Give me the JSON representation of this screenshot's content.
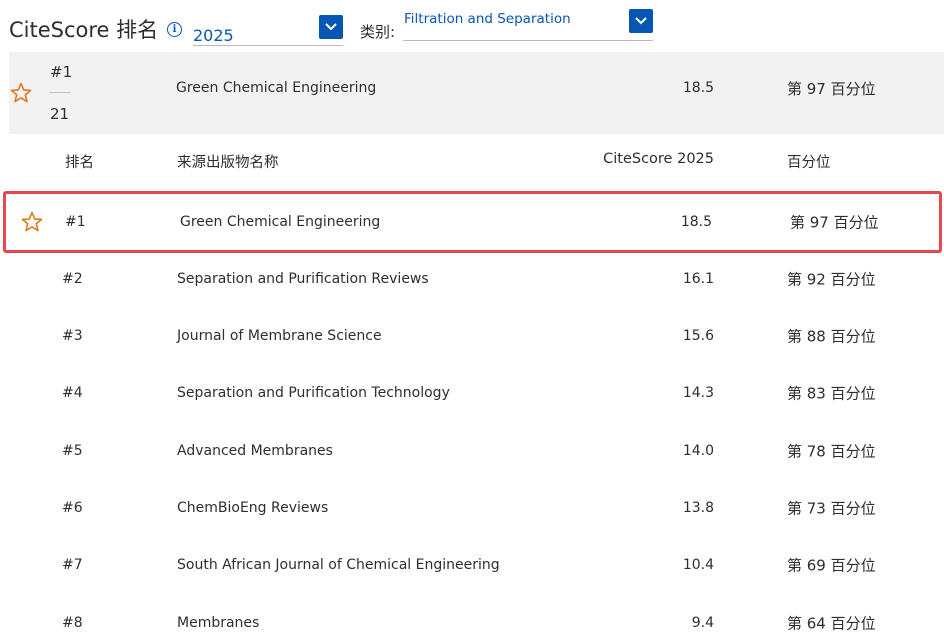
{
  "header": {
    "title": "CiteScore 排名",
    "year": "2025",
    "category_label": "类别:",
    "category": "Filtration and Separation"
  },
  "summary": {
    "rank": "#1",
    "total": "21",
    "name": "Green Chemical Engineering",
    "score": "18.5",
    "percentile": "第 97 百分位"
  },
  "columns": {
    "rank": "排名",
    "name": "来源出版物名称",
    "score": "CiteScore 2025",
    "percentile": "百分位"
  },
  "rows": [
    {
      "rank": "#1",
      "name": "Green Chemical Engineering",
      "score": "18.5",
      "percentile": "第 97 百分位"
    },
    {
      "rank": "#2",
      "name": "Separation and Purification Reviews",
      "score": "16.1",
      "percentile": "第 92 百分位"
    },
    {
      "rank": "#3",
      "name": "Journal of Membrane Science",
      "score": "15.6",
      "percentile": "第 88 百分位"
    },
    {
      "rank": "#4",
      "name": "Separation and Purification Technology",
      "score": "14.3",
      "percentile": "第 83 百分位"
    },
    {
      "rank": "#5",
      "name": "Advanced Membranes",
      "score": "14.0",
      "percentile": "第 78 百分位"
    },
    {
      "rank": "#6",
      "name": "ChemBioEng Reviews",
      "score": "13.8",
      "percentile": "第 73 百分位"
    },
    {
      "rank": "#7",
      "name": "South African Journal of Chemical Engineering",
      "score": "10.4",
      "percentile": "第 69 百分位"
    },
    {
      "rank": "#8",
      "name": "Membranes",
      "score": "9.4",
      "percentile": "第 64 百分位"
    }
  ],
  "colors": {
    "accent": "#0656b4",
    "highlight_border": "#e8474e",
    "star": "#e07a1f",
    "panel_bg": "#f2f2f2"
  },
  "icons": {
    "info": "info-icon",
    "dropdown": "chevron-down-icon",
    "star": "star-outline-icon"
  }
}
